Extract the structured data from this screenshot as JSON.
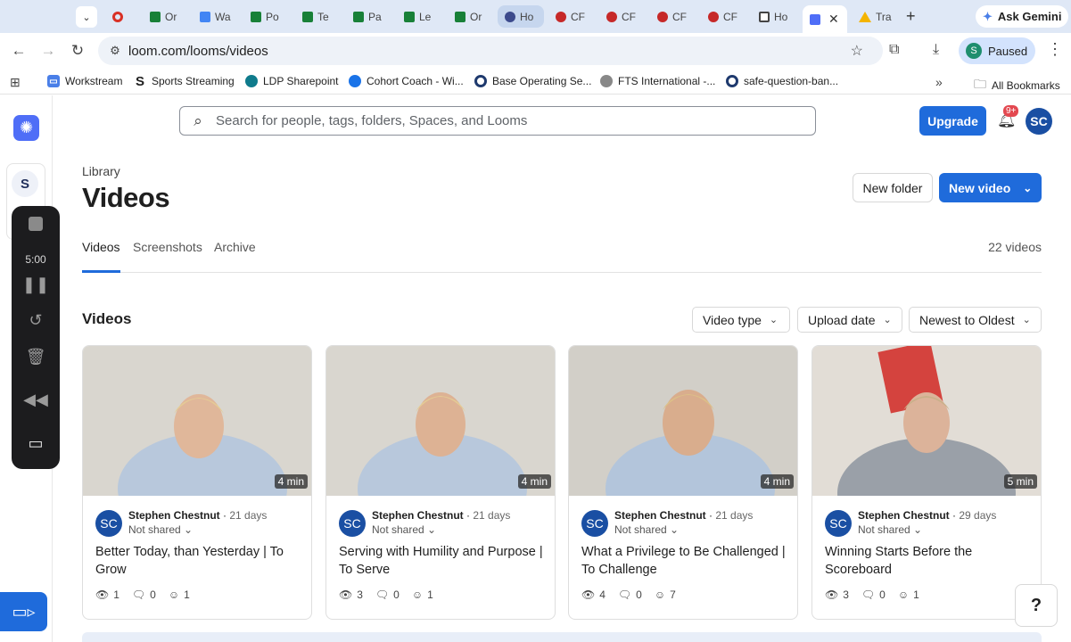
{
  "browser": {
    "tabs": [
      {
        "label": "",
        "color": "#d93025"
      },
      {
        "label": "Or",
        "color": "#188038"
      },
      {
        "label": "Wa",
        "color": "#4285f4"
      },
      {
        "label": "Po",
        "color": "#188038"
      },
      {
        "label": "Te",
        "color": "#188038"
      },
      {
        "label": "Pa",
        "color": "#188038"
      },
      {
        "label": "Le",
        "color": "#188038"
      },
      {
        "label": "Or",
        "color": "#188038"
      },
      {
        "label": "Ho",
        "color": "#3c4a8c"
      },
      {
        "label": "CF",
        "color": "#c62828"
      },
      {
        "label": "CF",
        "color": "#c62828"
      },
      {
        "label": "CF",
        "color": "#c62828"
      },
      {
        "label": "CF",
        "color": "#c62828"
      },
      {
        "label": "Ho",
        "color": "#444444"
      },
      {
        "label": "",
        "color": "#4f6ef7"
      },
      {
        "label": "Tra",
        "color": "#f4b400"
      }
    ],
    "gemini_label": "Ask Gemini",
    "url": "loom.com/looms/videos",
    "profile_label": "Paused",
    "profile_initial": "S",
    "bookmarks": [
      {
        "label": "Workstream",
        "color": "#4a7fe8"
      },
      {
        "label": "Sports Streaming",
        "color": "#1f1f1f"
      },
      {
        "label": "LDP Sharepoint",
        "color": "#0f7b8c"
      },
      {
        "label": "Cohort Coach - Wi...",
        "color": "#1a73e8"
      },
      {
        "label": "Base Operating Se...",
        "color": "#1f3a6e"
      },
      {
        "label": "FTS International -...",
        "color": "#555555"
      },
      {
        "label": "safe-question-ban...",
        "color": "#1f3a6e"
      }
    ],
    "all_bookmarks": "All Bookmarks"
  },
  "sidebar": {
    "workspace_initial": "S",
    "recorder_timer": "5:00"
  },
  "header": {
    "search_placeholder": "Search for people, tags, folders, Spaces, and Looms",
    "upgrade": "Upgrade",
    "notification_badge": "9+",
    "user_initials": "SC"
  },
  "page": {
    "breadcrumb": "Library",
    "title": "Videos",
    "new_folder": "New folder",
    "new_video": "New video",
    "tabs": [
      "Videos",
      "Screenshots",
      "Archive"
    ],
    "video_count": "22 videos",
    "section_title": "Videos",
    "filters": [
      "Video type",
      "Upload date",
      "Newest to Oldest"
    ]
  },
  "videos": [
    {
      "duration": "4 min",
      "initials": "SC",
      "owner": "Stephen Chestnut",
      "age": "21 days",
      "share": "Not shared",
      "title": "Better Today, than Yesterday | To Grow",
      "views": "1",
      "comments": "0",
      "reactions": "1"
    },
    {
      "duration": "4 min",
      "initials": "SC",
      "owner": "Stephen Chestnut",
      "age": "21 days",
      "share": "Not shared",
      "title": "Serving with Humility and Purpose | To Serve",
      "views": "3",
      "comments": "0",
      "reactions": "1"
    },
    {
      "duration": "4 min",
      "initials": "SC",
      "owner": "Stephen Chestnut",
      "age": "21 days",
      "share": "Not shared",
      "title": "What a Privilege to Be Challenged | To Challenge",
      "views": "4",
      "comments": "0",
      "reactions": "7"
    },
    {
      "duration": "5 min",
      "initials": "SC",
      "owner": "Stephen Chestnut",
      "age": "29 days",
      "share": "Not shared",
      "title": "Winning Starts Before the Scoreboard",
      "views": "3",
      "comments": "0",
      "reactions": "1"
    }
  ],
  "colors": {
    "accent": "#1f6bdb",
    "badge": "#e34850",
    "avatar": "#1a4fa3"
  }
}
